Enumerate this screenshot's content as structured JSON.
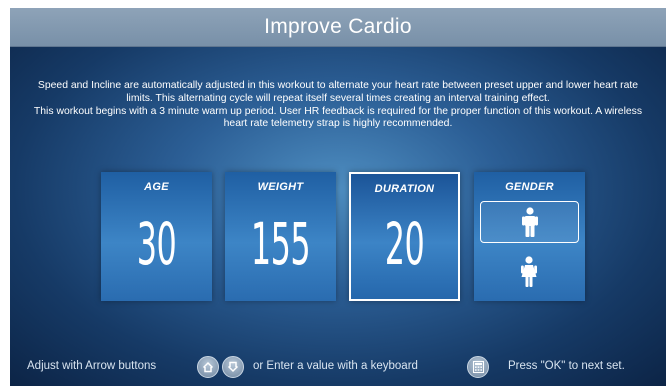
{
  "header": {
    "title": "Improve Cardio"
  },
  "description": {
    "paragraph1": "Speed and Incline are automatically adjusted in this workout to alternate your heart rate between preset upper and lower heart rate limits. This alternating cycle will repeat itself several times creating an interval training effect.",
    "paragraph2": "This workout begins with a 3 minute warm up period. User HR feedback is required for the proper function of this workout. A wireless heart rate  telemetry strap is highly recommended."
  },
  "fields": {
    "age": {
      "label": "AGE",
      "value": "30"
    },
    "weight": {
      "label": "WEIGHT",
      "value": "155"
    },
    "duration": {
      "label": "DURATION",
      "value": "20",
      "selected": true
    },
    "gender": {
      "label": "GENDER",
      "selected": "male",
      "options": [
        "male-icon",
        "female-icon"
      ]
    }
  },
  "footer": {
    "adjust_text": "Adjust with Arrow buttons",
    "or_text": "or  Enter a value with a keyboard",
    "ok_text": "Press \"OK\" to next set.",
    "icons": [
      "arrow-up-icon",
      "arrow-down-icon",
      "keyboard-icon"
    ]
  },
  "colors": {
    "card": "#2f74b8",
    "title_bar": "#8399b0",
    "background_center": "#4f8fc2",
    "background_edge": "#0c2446"
  }
}
